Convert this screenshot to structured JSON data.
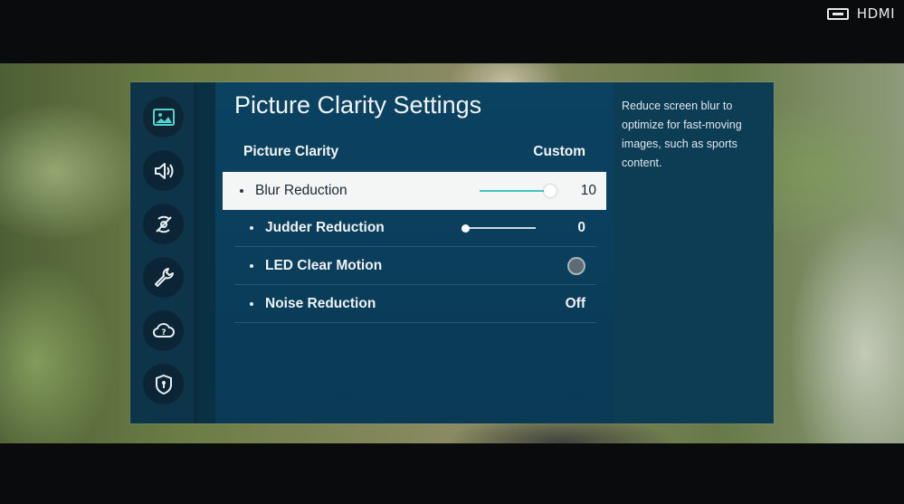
{
  "source_label": "HDMI",
  "menu": {
    "title": "Picture Clarity Settings",
    "header": {
      "label": "Picture Clarity",
      "value": "Custom"
    },
    "items": [
      {
        "label": "Blur Reduction",
        "value": "10",
        "control": "slider",
        "level_fraction": 1.0,
        "selected": true
      },
      {
        "label": "Judder Reduction",
        "value": "0",
        "control": "slider",
        "level_fraction": 0.0
      },
      {
        "label": "LED Clear Motion",
        "control": "radio",
        "checked": false
      },
      {
        "label": "Noise Reduction",
        "value": "Off",
        "control": "text"
      }
    ]
  },
  "sidebar": {
    "items": [
      {
        "icon": "picture-icon",
        "active": true
      },
      {
        "icon": "sound-icon"
      },
      {
        "icon": "broadcasting-icon"
      },
      {
        "icon": "general-wrench-icon"
      },
      {
        "icon": "support-cloud-icon"
      },
      {
        "icon": "privacy-shield-icon"
      }
    ]
  },
  "description": "Reduce screen blur to optimize for fast-moving images, such as sports content.",
  "colors": {
    "accent": "#3fc6c4",
    "panel": "#0b4261",
    "selected_bg": "#f4f5f5"
  }
}
